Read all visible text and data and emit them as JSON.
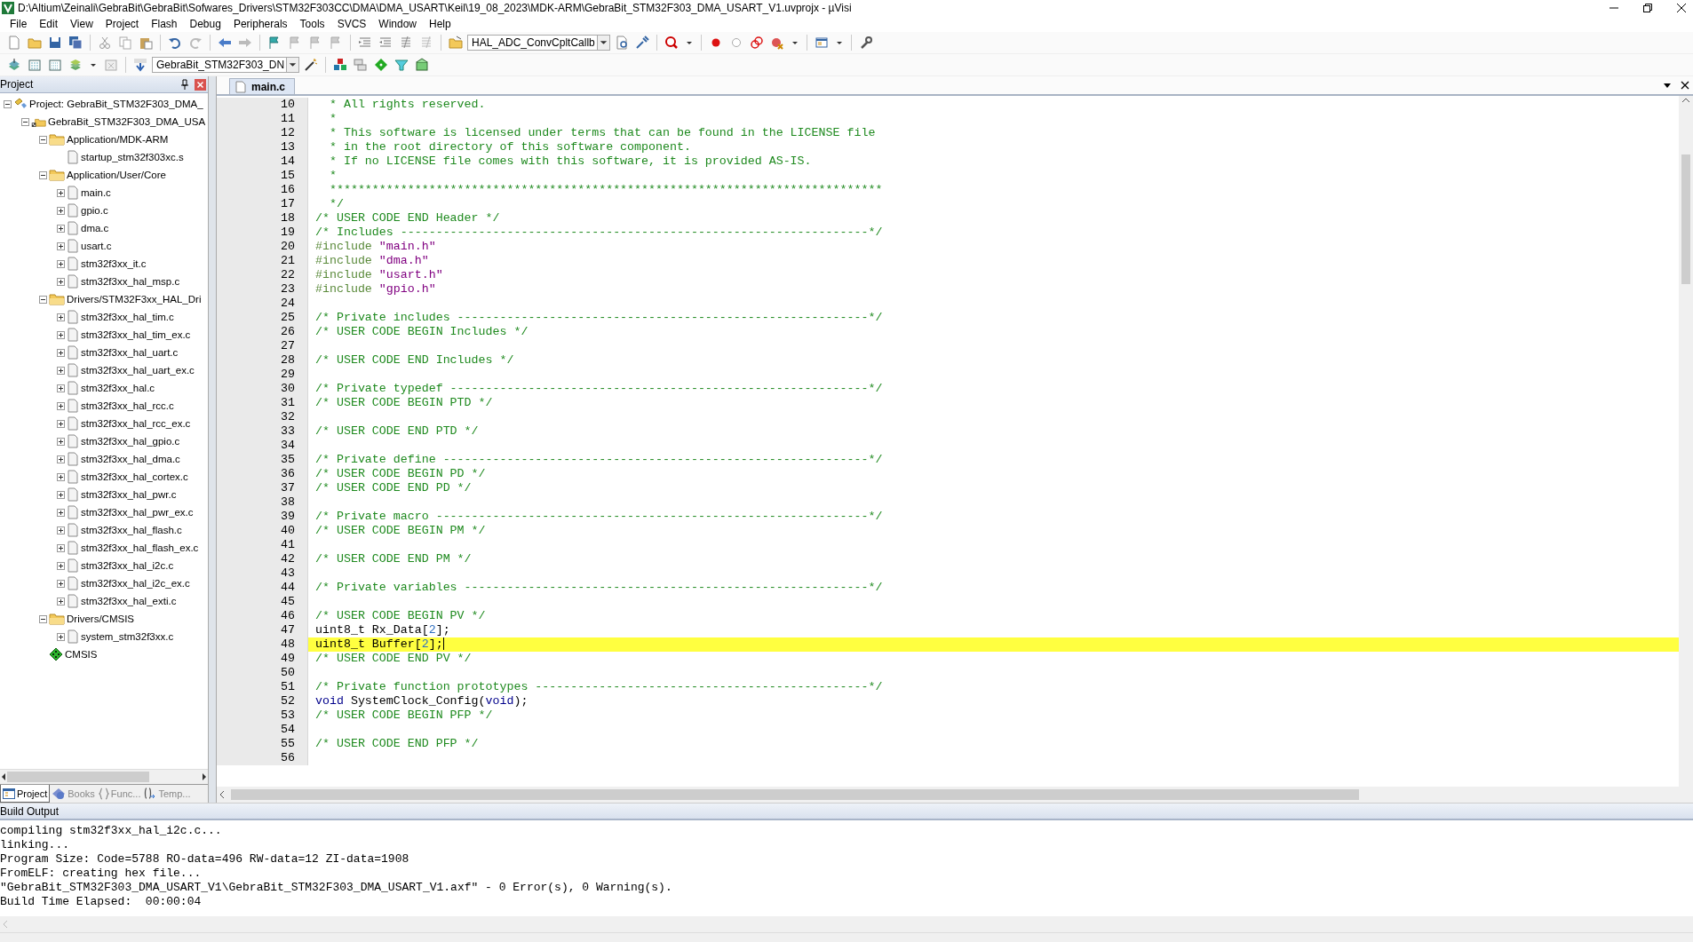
{
  "window": {
    "title": "D:\\Altium\\Zeinali\\GebraBit\\GebraBit\\Sofwares_Drivers\\STM32F303CC\\DMA\\DMA_USART\\Keil\\19_08_2023\\MDK-ARM\\GebraBit_STM32F303_DMA_USART_V1.uvprojx - µVisi"
  },
  "menu": [
    "File",
    "Edit",
    "View",
    "Project",
    "Flash",
    "Debug",
    "Peripherals",
    "Tools",
    "SVCS",
    "Window",
    "Help"
  ],
  "toolbar": {
    "function_combo": "HAL_ADC_ConvCpltCallb"
  },
  "build_toolbar": {
    "target_combo": "GebraBit_STM32F303_DN"
  },
  "project_panel": {
    "title": "Project",
    "tree": [
      {
        "kind": "project",
        "label": "Project: GebraBit_STM32F303_DMA_",
        "expanded": true,
        "children": [
          {
            "kind": "target",
            "label": "GebraBit_STM32F303_DMA_USA",
            "expanded": true,
            "children": [
              {
                "kind": "group",
                "label": "Application/MDK-ARM",
                "expanded": true,
                "children": [
                  {
                    "kind": "file",
                    "label": "startup_stm32f303xc.s"
                  }
                ]
              },
              {
                "kind": "group",
                "label": "Application/User/Core",
                "expanded": true,
                "children": [
                  {
                    "kind": "file",
                    "label": "main.c",
                    "expanded": false
                  },
                  {
                    "kind": "file",
                    "label": "gpio.c",
                    "expanded": false
                  },
                  {
                    "kind": "file",
                    "label": "dma.c",
                    "expanded": false
                  },
                  {
                    "kind": "file",
                    "label": "usart.c",
                    "expanded": false
                  },
                  {
                    "kind": "file",
                    "label": "stm32f3xx_it.c",
                    "expanded": false
                  },
                  {
                    "kind": "file",
                    "label": "stm32f3xx_hal_msp.c",
                    "expanded": false
                  }
                ]
              },
              {
                "kind": "group",
                "label": "Drivers/STM32F3xx_HAL_Dri",
                "expanded": true,
                "children": [
                  {
                    "kind": "file",
                    "label": "stm32f3xx_hal_tim.c",
                    "expanded": false
                  },
                  {
                    "kind": "file",
                    "label": "stm32f3xx_hal_tim_ex.c",
                    "expanded": false
                  },
                  {
                    "kind": "file",
                    "label": "stm32f3xx_hal_uart.c",
                    "expanded": false
                  },
                  {
                    "kind": "file",
                    "label": "stm32f3xx_hal_uart_ex.c",
                    "expanded": false
                  },
                  {
                    "kind": "file",
                    "label": "stm32f3xx_hal.c",
                    "expanded": false
                  },
                  {
                    "kind": "file",
                    "label": "stm32f3xx_hal_rcc.c",
                    "expanded": false
                  },
                  {
                    "kind": "file",
                    "label": "stm32f3xx_hal_rcc_ex.c",
                    "expanded": false
                  },
                  {
                    "kind": "file",
                    "label": "stm32f3xx_hal_gpio.c",
                    "expanded": false
                  },
                  {
                    "kind": "file",
                    "label": "stm32f3xx_hal_dma.c",
                    "expanded": false
                  },
                  {
                    "kind": "file",
                    "label": "stm32f3xx_hal_cortex.c",
                    "expanded": false
                  },
                  {
                    "kind": "file",
                    "label": "stm32f3xx_hal_pwr.c",
                    "expanded": false
                  },
                  {
                    "kind": "file",
                    "label": "stm32f3xx_hal_pwr_ex.c",
                    "expanded": false
                  },
                  {
                    "kind": "file",
                    "label": "stm32f3xx_hal_flash.c",
                    "expanded": false
                  },
                  {
                    "kind": "file",
                    "label": "stm32f3xx_hal_flash_ex.c",
                    "expanded": false
                  },
                  {
                    "kind": "file",
                    "label": "stm32f3xx_hal_i2c.c",
                    "expanded": false
                  },
                  {
                    "kind": "file",
                    "label": "stm32f3xx_hal_i2c_ex.c",
                    "expanded": false
                  },
                  {
                    "kind": "file",
                    "label": "stm32f3xx_hal_exti.c",
                    "expanded": false
                  }
                ]
              },
              {
                "kind": "group",
                "label": "Drivers/CMSIS",
                "expanded": true,
                "children": [
                  {
                    "kind": "file",
                    "label": "system_stm32f3xx.c",
                    "expanded": false
                  }
                ]
              },
              {
                "kind": "component",
                "label": "CMSIS"
              }
            ]
          }
        ]
      }
    ],
    "tabs": [
      {
        "kind": "project",
        "label": "Project",
        "selected": true
      },
      {
        "kind": "books",
        "label": "Books",
        "selected": false
      },
      {
        "kind": "functions",
        "label": "Func...",
        "selected": false
      },
      {
        "kind": "templates",
        "label": "Temp...",
        "selected": false
      }
    ]
  },
  "editor": {
    "tabs": [
      {
        "label": "main.c",
        "selected": true
      }
    ],
    "lines": [
      {
        "number": "10",
        "current": false,
        "segments": [
          {
            "kind": "comment",
            "text": "  * All rights reserved."
          }
        ]
      },
      {
        "number": "11",
        "current": false,
        "segments": [
          {
            "kind": "comment",
            "text": "  *"
          }
        ]
      },
      {
        "number": "12",
        "current": false,
        "segments": [
          {
            "kind": "comment",
            "text": "  * This software is licensed under terms that can be found in the LICENSE file"
          }
        ]
      },
      {
        "number": "13",
        "current": false,
        "segments": [
          {
            "kind": "comment",
            "text": "  * in the root directory of this software component."
          }
        ]
      },
      {
        "number": "14",
        "current": false,
        "segments": [
          {
            "kind": "comment",
            "text": "  * If no LICENSE file comes with this software, it is provided AS-IS."
          }
        ]
      },
      {
        "number": "15",
        "current": false,
        "segments": [
          {
            "kind": "comment",
            "text": "  *"
          }
        ]
      },
      {
        "number": "16",
        "current": false,
        "segments": [
          {
            "kind": "comment",
            "text": "  ******************************************************************************"
          }
        ]
      },
      {
        "number": "17",
        "current": false,
        "segments": [
          {
            "kind": "comment",
            "text": "  */"
          }
        ]
      },
      {
        "number": "18",
        "current": false,
        "segments": [
          {
            "kind": "comment",
            "text": "/* USER CODE END Header */"
          }
        ]
      },
      {
        "number": "19",
        "current": false,
        "segments": [
          {
            "kind": "comment",
            "text": "/* Includes ------------------------------------------------------------------*/"
          }
        ]
      },
      {
        "number": "20",
        "current": false,
        "segments": [
          {
            "kind": "preprocessor",
            "text": "#include "
          },
          {
            "kind": "string",
            "text": "\"main.h\""
          }
        ]
      },
      {
        "number": "21",
        "current": false,
        "segments": [
          {
            "kind": "preprocessor",
            "text": "#include "
          },
          {
            "kind": "string",
            "text": "\"dma.h\""
          }
        ]
      },
      {
        "number": "22",
        "current": false,
        "segments": [
          {
            "kind": "preprocessor",
            "text": "#include "
          },
          {
            "kind": "string",
            "text": "\"usart.h\""
          }
        ]
      },
      {
        "number": "23",
        "current": false,
        "segments": [
          {
            "kind": "preprocessor",
            "text": "#include "
          },
          {
            "kind": "string",
            "text": "\"gpio.h\""
          }
        ]
      },
      {
        "number": "24",
        "current": false
      },
      {
        "number": "25",
        "current": false,
        "segments": [
          {
            "kind": "comment",
            "text": "/* Private includes ----------------------------------------------------------*/"
          }
        ]
      },
      {
        "number": "26",
        "current": false,
        "segments": [
          {
            "kind": "comment",
            "text": "/* USER CODE BEGIN Includes */"
          }
        ]
      },
      {
        "number": "27",
        "current": false
      },
      {
        "number": "28",
        "current": false,
        "segments": [
          {
            "kind": "comment",
            "text": "/* USER CODE END Includes */"
          }
        ]
      },
      {
        "number": "29",
        "current": false
      },
      {
        "number": "30",
        "current": false,
        "segments": [
          {
            "kind": "comment",
            "text": "/* Private typedef -----------------------------------------------------------*/"
          }
        ]
      },
      {
        "number": "31",
        "current": false,
        "segments": [
          {
            "kind": "comment",
            "text": "/* USER CODE BEGIN PTD */"
          }
        ]
      },
      {
        "number": "32",
        "current": false
      },
      {
        "number": "33",
        "current": false,
        "segments": [
          {
            "kind": "comment",
            "text": "/* USER CODE END PTD */"
          }
        ]
      },
      {
        "number": "34",
        "current": false
      },
      {
        "number": "35",
        "current": false,
        "segments": [
          {
            "kind": "comment",
            "text": "/* Private define ------------------------------------------------------------*/"
          }
        ]
      },
      {
        "number": "36",
        "current": false,
        "segments": [
          {
            "kind": "comment",
            "text": "/* USER CODE BEGIN PD */"
          }
        ]
      },
      {
        "number": "37",
        "current": false,
        "segments": [
          {
            "kind": "comment",
            "text": "/* USER CODE END PD */"
          }
        ]
      },
      {
        "number": "38",
        "current": false
      },
      {
        "number": "39",
        "current": false,
        "segments": [
          {
            "kind": "comment",
            "text": "/* Private macro -------------------------------------------------------------*/"
          }
        ]
      },
      {
        "number": "40",
        "current": false,
        "segments": [
          {
            "kind": "comment",
            "text": "/* USER CODE BEGIN PM */"
          }
        ]
      },
      {
        "number": "41",
        "current": false
      },
      {
        "number": "42",
        "current": false,
        "segments": [
          {
            "kind": "comment",
            "text": "/* USER CODE END PM */"
          }
        ]
      },
      {
        "number": "43",
        "current": false
      },
      {
        "number": "44",
        "current": false,
        "segments": [
          {
            "kind": "comment",
            "text": "/* Private variables ---------------------------------------------------------*/"
          }
        ]
      },
      {
        "number": "45",
        "current": false
      },
      {
        "number": "46",
        "current": false,
        "segments": [
          {
            "kind": "comment",
            "text": "/* USER CODE BEGIN PV */"
          }
        ]
      },
      {
        "number": "47",
        "current": false,
        "segments": [
          {
            "kind": "plain",
            "text": "uint8_t Rx_Data["
          },
          {
            "kind": "number",
            "text": "2"
          },
          {
            "kind": "plain",
            "text": "];"
          }
        ]
      },
      {
        "number": "48",
        "current": true,
        "segments": [
          {
            "kind": "plain",
            "text": "uint8_t Buffer["
          },
          {
            "kind": "number",
            "text": "2"
          },
          {
            "kind": "plain",
            "text": "];"
          }
        ]
      },
      {
        "number": "49",
        "current": false,
        "segments": [
          {
            "kind": "comment",
            "text": "/* USER CODE END PV */"
          }
        ]
      },
      {
        "number": "50",
        "current": false
      },
      {
        "number": "51",
        "current": false,
        "segments": [
          {
            "kind": "comment",
            "text": "/* Private function prototypes -----------------------------------------------*/"
          }
        ]
      },
      {
        "number": "52",
        "current": false,
        "segments": [
          {
            "kind": "keyword",
            "text": "void"
          },
          {
            "kind": "plain",
            "text": " SystemClock_Config("
          },
          {
            "kind": "keyword",
            "text": "void"
          },
          {
            "kind": "plain",
            "text": ");"
          }
        ]
      },
      {
        "number": "53",
        "current": false,
        "segments": [
          {
            "kind": "comment",
            "text": "/* USER CODE BEGIN PFP */"
          }
        ]
      },
      {
        "number": "54",
        "current": false
      },
      {
        "number": "55",
        "current": false,
        "segments": [
          {
            "kind": "comment",
            "text": "/* USER CODE END PFP */"
          }
        ]
      },
      {
        "number": "56",
        "current": false
      }
    ]
  },
  "build_output": {
    "title": "Build Output",
    "lines": [
      "compiling stm32f3xx_hal_i2c.c...",
      "linking...",
      "Program Size: Code=5788 RO-data=496 RW-data=12 ZI-data=1908",
      "FromELF: creating hex file...",
      "\"GebraBit_STM32F303_DMA_USART_V1\\GebraBit_STM32F303_DMA_USART_V1.axf\" - 0 Error(s), 0 Warning(s).",
      "Build Time Elapsed:  00:00:04"
    ]
  }
}
